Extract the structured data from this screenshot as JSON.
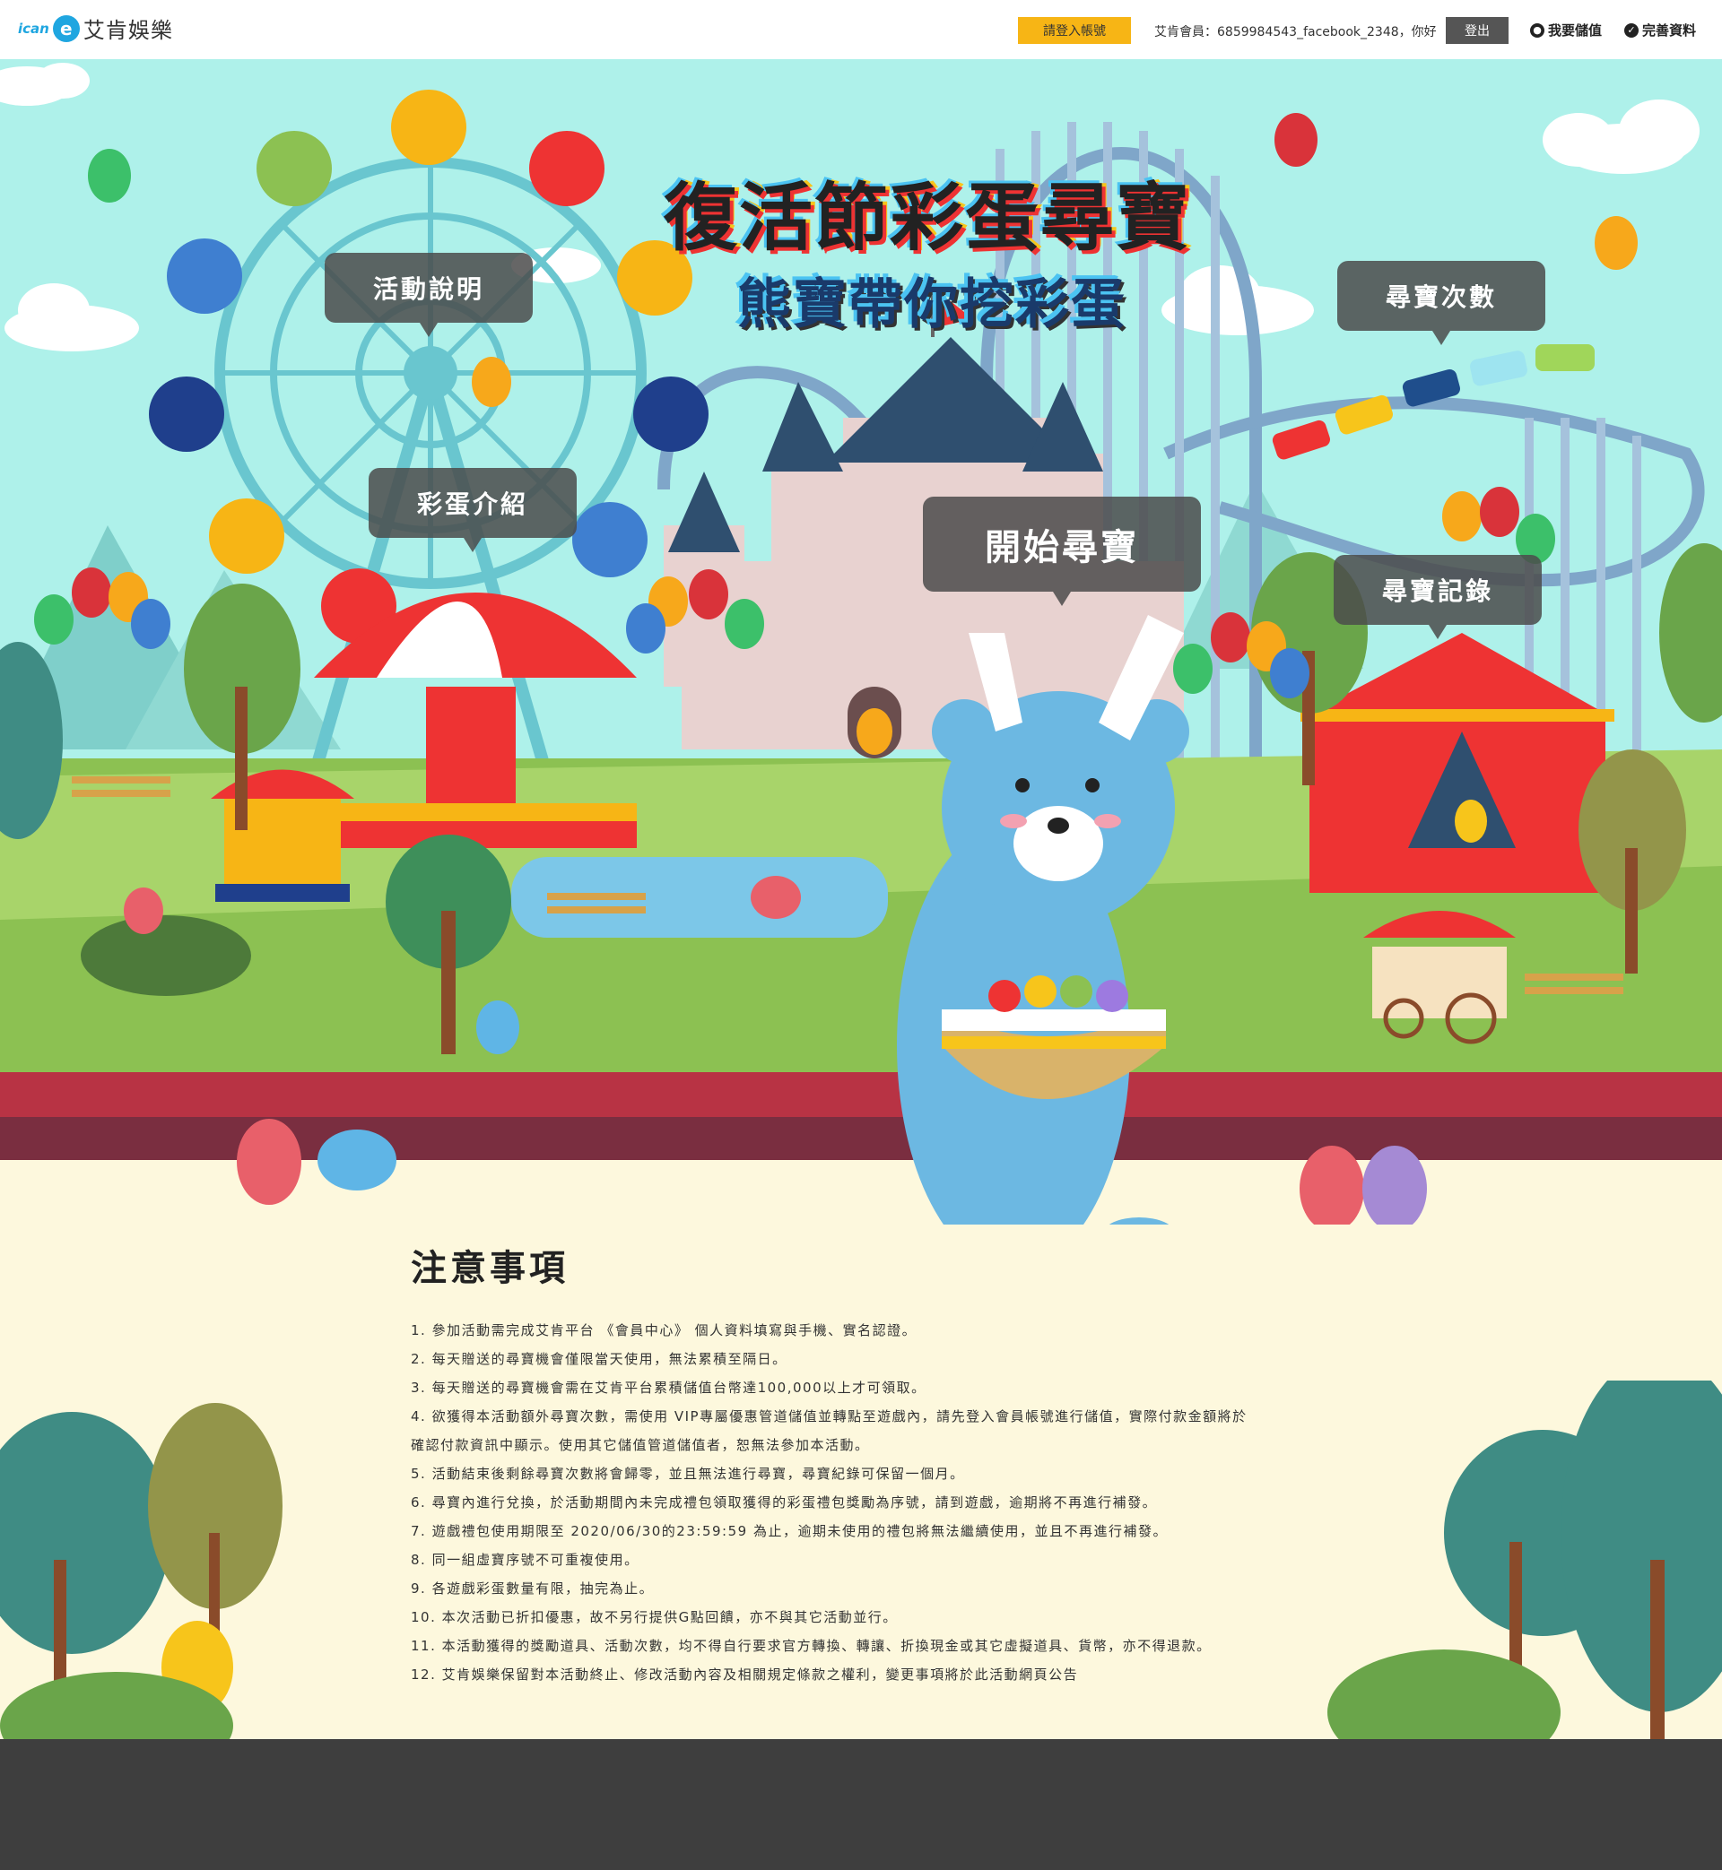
{
  "header": {
    "logo_mark": "ican",
    "logo_e": "e",
    "logo_text": "艾肯娛樂",
    "login_label": "請登入帳號",
    "member_text": "艾肯會員：6859984543_facebook_2348，你好",
    "logout_label": "登出",
    "topup_label": "我要儲值",
    "profile_label": "完善資料",
    "topup_icon": "user-icon",
    "profile_icon": "check-circle-icon"
  },
  "hero": {
    "title": "復活節彩蛋尋寶",
    "subtitle": "熊寶帶你挖彩蛋",
    "bubbles": {
      "event_info": "活動說明",
      "egg_intro": "彩蛋介紹",
      "start_hunt": "開始尋寶",
      "hunt_count": "尋寶次數",
      "hunt_record": "尋寶記錄"
    }
  },
  "notes": {
    "title": "注意事項",
    "items": [
      "1. 參加活動需完成艾肯平台 《會員中心》 個人資料填寫與手機、實名認證。",
      "2. 每天贈送的尋寶機會僅限當天使用，無法累積至隔日。",
      "3. 每天贈送的尋寶機會需在艾肯平台累積儲值台幣達100,000以上才可領取。",
      "4. 欲獲得本活動額外尋寶次數，需使用 VIP專屬優惠管道儲值並轉點至遊戲內，請先登入會員帳號進行儲值，實際付款金額將於",
      "確認付款資訊中顯示。使用其它儲值管道儲值者，恕無法參加本活動。",
      "5. 活動結束後剩餘尋寶次數將會歸零，並且無法進行尋寶，尋寶紀錄可保留一個月。",
      "6. 尋寶內進行兌換，於活動期間內未完成禮包領取獲得的彩蛋禮包獎勵為序號，請到遊戲，逾期將不再進行補發。",
      "7. 遊戲禮包使用期限至 2020/06/30的23:59:59 為止，逾期未使用的禮包將無法繼續使用，並且不再進行補發。",
      "8. 同一組虛寶序號不可重複使用。",
      "9. 各遊戲彩蛋數量有限，抽完為止。",
      "10. 本次活動已折扣優惠，故不另行提供G點回饋，亦不與其它活動並行。",
      "11. 本活動獲得的獎勵道具、活動次數，均不得自行要求官方轉換、轉讓、折換現金或其它虛擬道具、貨幣，亦不得退款。",
      "12. 艾肯娛樂保留對本活動終止、修改活動內容及相關規定條款之權利，變更事項將於此活動網頁公告"
    ]
  },
  "colors": {
    "sky": "#aef1ea",
    "grass": "#8cc152",
    "accent_yellow": "#f7b515",
    "bear": "#6cb8e2",
    "footer": "#3e3e3e"
  }
}
